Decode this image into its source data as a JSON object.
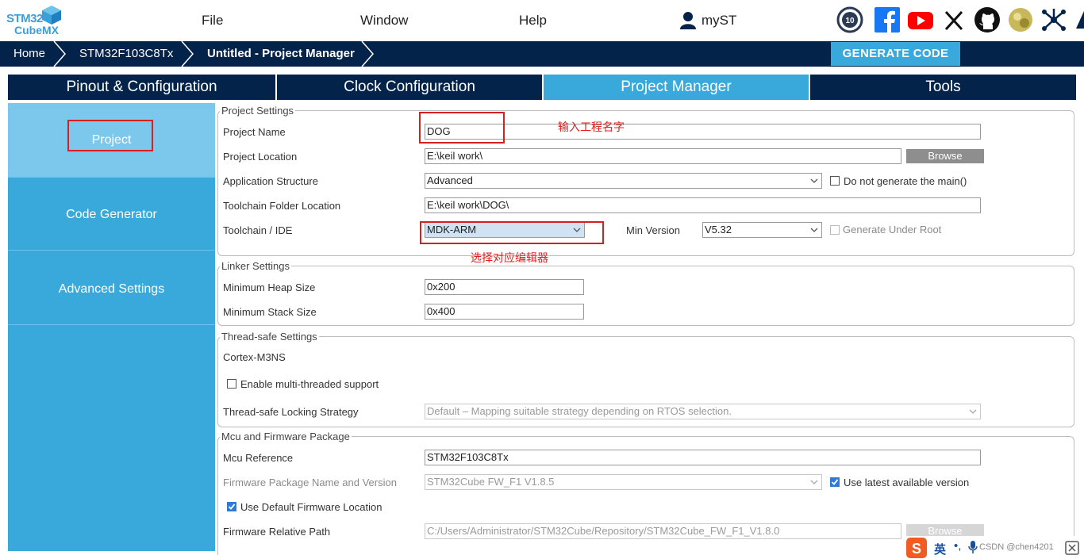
{
  "app": {
    "logo_line1": "STM32",
    "logo_line2": "CubeMX",
    "menu": [
      "File",
      "Window",
      "Help"
    ],
    "user": "myST"
  },
  "breadcrumb": [
    "Home",
    "STM32F103C8Tx",
    "Untitled - Project Manager"
  ],
  "generate_button": "GENERATE CODE",
  "tabs": [
    {
      "label": "Pinout & Configuration",
      "active": false
    },
    {
      "label": "Clock Configuration",
      "active": false
    },
    {
      "label": "Project Manager",
      "active": true
    },
    {
      "label": "Tools",
      "active": false
    }
  ],
  "sidebar": [
    "Project",
    "Code Generator",
    "Advanced Settings"
  ],
  "project_settings": {
    "legend": "Project Settings",
    "project_name_label": "Project Name",
    "project_name_value": "DOG",
    "project_location_label": "Project Location",
    "project_location_value": "E:\\keil work\\",
    "browse": "Browse",
    "app_structure_label": "Application Structure",
    "app_structure_value": "Advanced",
    "no_main_label": "Do not generate the main()",
    "toolchain_folder_label": "Toolchain Folder Location",
    "toolchain_folder_value": "E:\\keil work\\DOG\\",
    "toolchain_label": "Toolchain / IDE",
    "toolchain_value": "MDK-ARM",
    "min_version_label": "Min Version",
    "min_version_value": "V5.32",
    "gen_under_root_label": "Generate Under Root"
  },
  "linker": {
    "legend": "Linker Settings",
    "heap_label": "Minimum Heap Size",
    "heap_value": "0x200",
    "stack_label": "Minimum Stack Size",
    "stack_value": "0x400"
  },
  "thread": {
    "legend": "Thread-safe Settings",
    "core": "Cortex-M3NS",
    "multithread_label": "Enable multi-threaded support",
    "strategy_label": "Thread-safe Locking Strategy",
    "strategy_value": "Default  –  Mapping suitable strategy depending on RTOS selection."
  },
  "mcu": {
    "legend": "Mcu and Firmware Package",
    "ref_label": "Mcu Reference",
    "ref_value": "STM32F103C8Tx",
    "fw_label": "Firmware Package Name and Version",
    "fw_value": "STM32Cube FW_F1 V1.8.5",
    "latest_label": "Use latest available version",
    "default_loc_label": "Use Default Firmware Location",
    "rel_path_label": "Firmware Relative Path",
    "rel_path_value": "C:/Users/Administrator/STM32Cube/Repository/STM32Cube_FW_F1_V1.8.0",
    "browse": "Browse"
  },
  "annotations": {
    "name_hint": "输入工程名字",
    "ide_hint": "选择对应编辑器"
  },
  "ime": {
    "lang": "英",
    "watermark": "CSDN @chen4201"
  },
  "colors": {
    "navy": "#03234b",
    "accent": "#39a9dc",
    "sidebar_active": "#7cc8ec",
    "annotation_red": "#d62020"
  }
}
